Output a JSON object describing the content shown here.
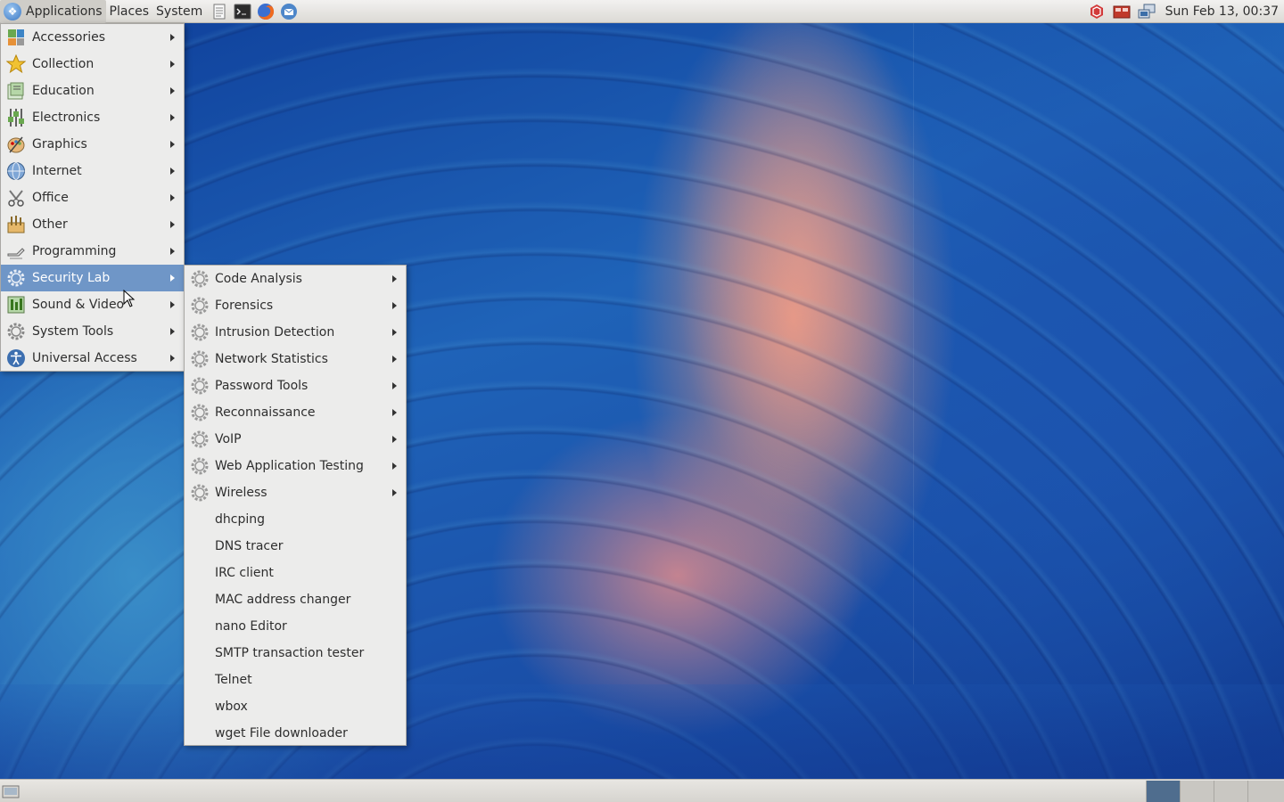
{
  "top_panel": {
    "applications_label": "Applications",
    "places_label": "Places",
    "system_label": "System",
    "clock": "Sun Feb 13, 00:37"
  },
  "main_menu": {
    "items": [
      {
        "label": "Accessories",
        "icon": "accessories-icon"
      },
      {
        "label": "Collection",
        "icon": "star-icon"
      },
      {
        "label": "Education",
        "icon": "education-icon"
      },
      {
        "label": "Electronics",
        "icon": "electronics-icon"
      },
      {
        "label": "Graphics",
        "icon": "graphics-icon"
      },
      {
        "label": "Internet",
        "icon": "globe-icon"
      },
      {
        "label": "Office",
        "icon": "office-icon"
      },
      {
        "label": "Other",
        "icon": "other-icon"
      },
      {
        "label": "Programming",
        "icon": "programming-icon"
      },
      {
        "label": "Security Lab",
        "icon": "gear-icon",
        "highlighted": true
      },
      {
        "label": "Sound & Video",
        "icon": "sound-video-icon"
      },
      {
        "label": "System Tools",
        "icon": "gear-icon"
      },
      {
        "label": "Universal Access",
        "icon": "accessibility-icon"
      }
    ]
  },
  "security_lab_menu": {
    "submenus": [
      "Code Analysis",
      "Forensics",
      "Intrusion Detection",
      "Network Statistics",
      "Password Tools",
      "Reconnaissance",
      "VoIP",
      "Web Application Testing",
      "Wireless"
    ],
    "apps": [
      "dhcping",
      "DNS tracer",
      "IRC client",
      "MAC address changer",
      "nano Editor",
      "SMTP transaction tester",
      "Telnet",
      "wbox",
      "wget File downloader"
    ]
  },
  "colors": {
    "menu_bg": "#ececeb",
    "highlight": "#6f96c7",
    "panel": "#e6e4e0",
    "active_workspace": "#4f6d8e"
  }
}
